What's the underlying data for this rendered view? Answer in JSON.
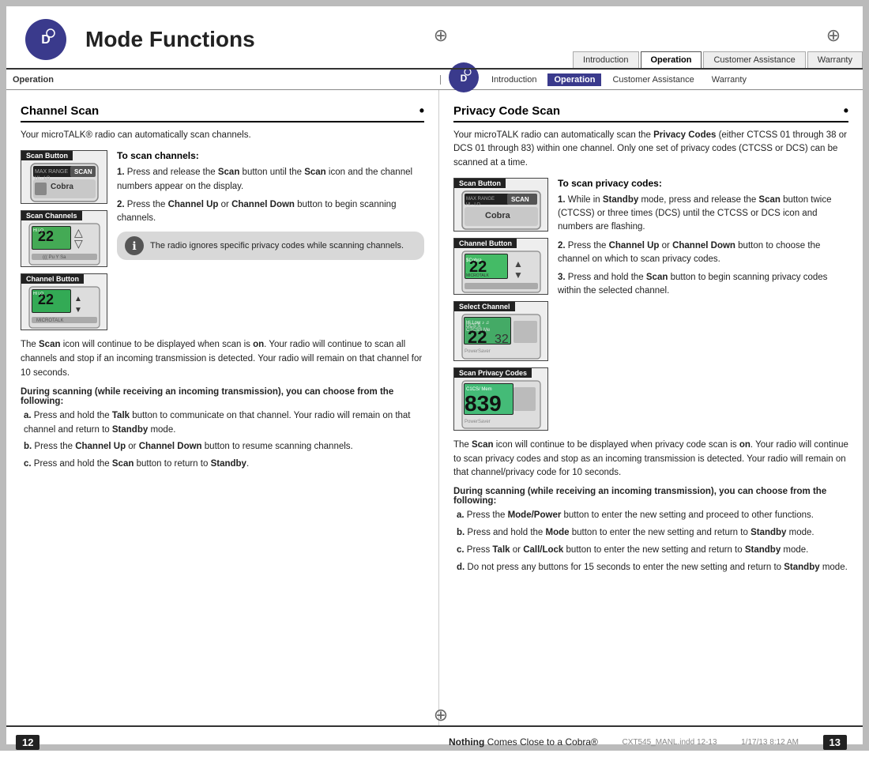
{
  "page": {
    "title": "Mode Functions",
    "border_color": "#bbbbbb"
  },
  "header": {
    "logo_text": "D",
    "title": "Mode Functions",
    "nav_tabs": [
      {
        "label": "Introduction",
        "active": false
      },
      {
        "label": "Operation",
        "active": true
      },
      {
        "label": "Customer Assistance",
        "active": false
      },
      {
        "label": "Warranty",
        "active": false
      }
    ],
    "sub_left": "Operation",
    "sub_right_logo": "D"
  },
  "left": {
    "section_title": "Channel Scan",
    "intro": "Your microTALK® radio can automatically scan channels.",
    "scan_button_label": "Scan Button",
    "scan_channels_label": "Scan Channels",
    "channel_button_label": "Channel Button",
    "instruction_title": "To scan channels:",
    "steps": [
      {
        "num": "1.",
        "text": "Press and release the Scan button until the Scan icon and the channel numbers appear on the display."
      },
      {
        "num": "2.",
        "text": "Press the Channel Up or Channel Down button to begin scanning channels."
      }
    ],
    "note_text": "The radio ignores specific privacy codes while scanning channels.",
    "body1": "The Scan icon will continue to be displayed when scan is on. Your radio will continue to scan all channels and stop if an incoming transmission is detected. Your radio will remain on that channel for 10 seconds.",
    "during_bold": "During scanning (while receiving an incoming transmission), you can choose from the following:",
    "during_items": [
      {
        "letter": "a",
        "text": "Press and hold the Talk button to communicate on that channel. Your radio will remain on that channel and return to Standby mode."
      },
      {
        "letter": "b",
        "text": "Press the Channel Up or Channel Down button to resume scanning channels."
      },
      {
        "letter": "c",
        "text": "Press and hold the Scan button to return to Standby."
      }
    ]
  },
  "right": {
    "section_title": "Privacy Code Scan",
    "intro": "Your microTALK radio can automatically scan the Privacy Codes (either CTCSS 01 through 38 or DCS 01 through 83) within one channel. Only one set of privacy codes (CTCSS or DCS) can be scanned at a time.",
    "scan_button_label": "Scan Button",
    "channel_button_label": "Channel Button",
    "select_channel_label": "Select Channel",
    "scan_privacy_label": "Scan Privacy Codes",
    "instruction_title": "To scan privacy codes:",
    "steps": [
      {
        "num": "1.",
        "text": "While in Standby mode, press and release the Scan button twice (CTCSS) or three times (DCS) until the CTCSS or DCS icon and numbers are flashing."
      },
      {
        "num": "2.",
        "text": "Press the Channel Up or Channel Down button to choose the channel on which to scan privacy codes."
      },
      {
        "num": "3.",
        "text": "Press and hold the Scan button to begin scanning privacy codes within the selected channel."
      }
    ],
    "body1": "The Scan icon will continue to be displayed when privacy code scan is on. Your radio will continue to scan privacy codes and stop as an incoming transmission is detected. Your radio will remain on that channel/privacy code for 10 seconds.",
    "during_bold": "During scanning (while receiving an incoming transmission), you can choose from the following:",
    "during_items": [
      {
        "letter": "a",
        "text": "Press the Mode/Power button to enter the new setting and proceed to other functions."
      },
      {
        "letter": "b",
        "text": "Press and hold the Mode button to enter the new setting and return to Standby mode."
      },
      {
        "letter": "c",
        "text": "Press Talk or Call/Lock button to enter the new setting and return to Standby mode."
      },
      {
        "letter": "d",
        "text": "Do not press any buttons for 15 seconds to enter the new setting and return to Standby mode."
      }
    ]
  },
  "footer": {
    "page_left": "12",
    "page_right": "13",
    "tagline_normal": "Nothing",
    "tagline_rest": " Comes Close to a Cobra®",
    "filename": "CXT545_MANL.indd   12-13",
    "date": "1/17/13   8:12 AM"
  }
}
